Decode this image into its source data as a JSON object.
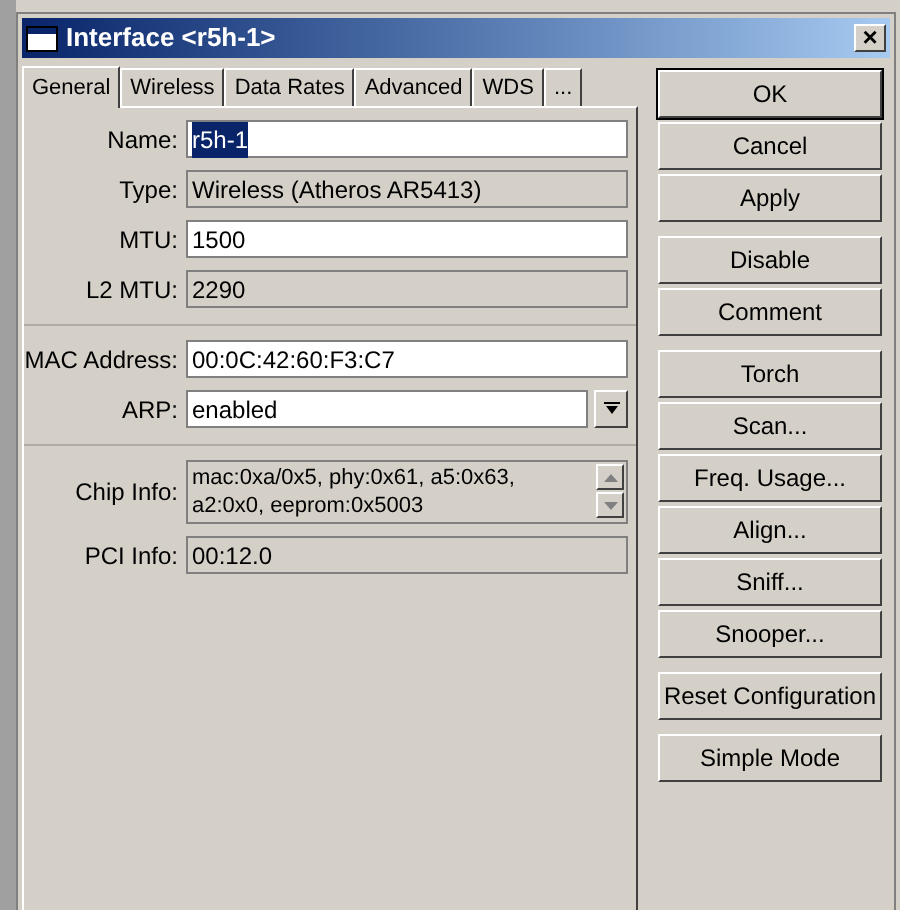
{
  "window": {
    "title": "Interface <r5h-1>",
    "close": "×"
  },
  "tabs": [
    {
      "label": "General",
      "selected": true
    },
    {
      "label": "Wireless",
      "selected": false
    },
    {
      "label": "Data Rates",
      "selected": false
    },
    {
      "label": "Advanced",
      "selected": false
    },
    {
      "label": "WDS",
      "selected": false
    },
    {
      "label": "...",
      "selected": false
    }
  ],
  "field_groups": [
    [
      {
        "label": "Name:",
        "value": "r5h-1",
        "kind": "text",
        "editable": true,
        "highlighted": true
      },
      {
        "label": "Type:",
        "value": "Wireless (Atheros AR5413)",
        "kind": "text",
        "editable": false,
        "highlighted": false
      },
      {
        "label": "MTU:",
        "value": "1500",
        "kind": "text",
        "editable": true,
        "highlighted": false
      },
      {
        "label": "L2 MTU:",
        "value": "2290",
        "kind": "text",
        "editable": false,
        "highlighted": false
      }
    ],
    [
      {
        "label": "MAC Address:",
        "value": "00:0C:42:60:F3:C7",
        "kind": "text",
        "editable": true,
        "highlighted": false
      },
      {
        "label": "ARP:",
        "value": "enabled",
        "kind": "dropdown",
        "editable": true,
        "highlighted": false
      }
    ],
    [
      {
        "label": "Chip Info:",
        "value": "mac:0xa/0x5, phy:0x61, a5:0x63, a2:0x0, eeprom:0x5003",
        "kind": "multiline",
        "editable": false,
        "highlighted": false
      },
      {
        "label": "PCI Info:",
        "value": "00:12.0",
        "kind": "text",
        "editable": false,
        "highlighted": false
      }
    ]
  ],
  "button_groups": [
    [
      {
        "label": "OK",
        "default": true
      },
      {
        "label": "Cancel",
        "default": false
      },
      {
        "label": "Apply",
        "default": false
      }
    ],
    [
      {
        "label": "Disable",
        "default": false
      },
      {
        "label": "Comment",
        "default": false
      }
    ],
    [
      {
        "label": "Torch",
        "default": false
      },
      {
        "label": "Scan...",
        "default": false
      },
      {
        "label": "Freq. Usage...",
        "default": false
      },
      {
        "label": "Align...",
        "default": false
      },
      {
        "label": "Sniff...",
        "default": false
      },
      {
        "label": "Snooper...",
        "default": false
      }
    ],
    [
      {
        "label": "Reset Configuration",
        "default": false
      }
    ],
    [
      {
        "label": "Simple Mode",
        "default": false
      }
    ]
  ]
}
